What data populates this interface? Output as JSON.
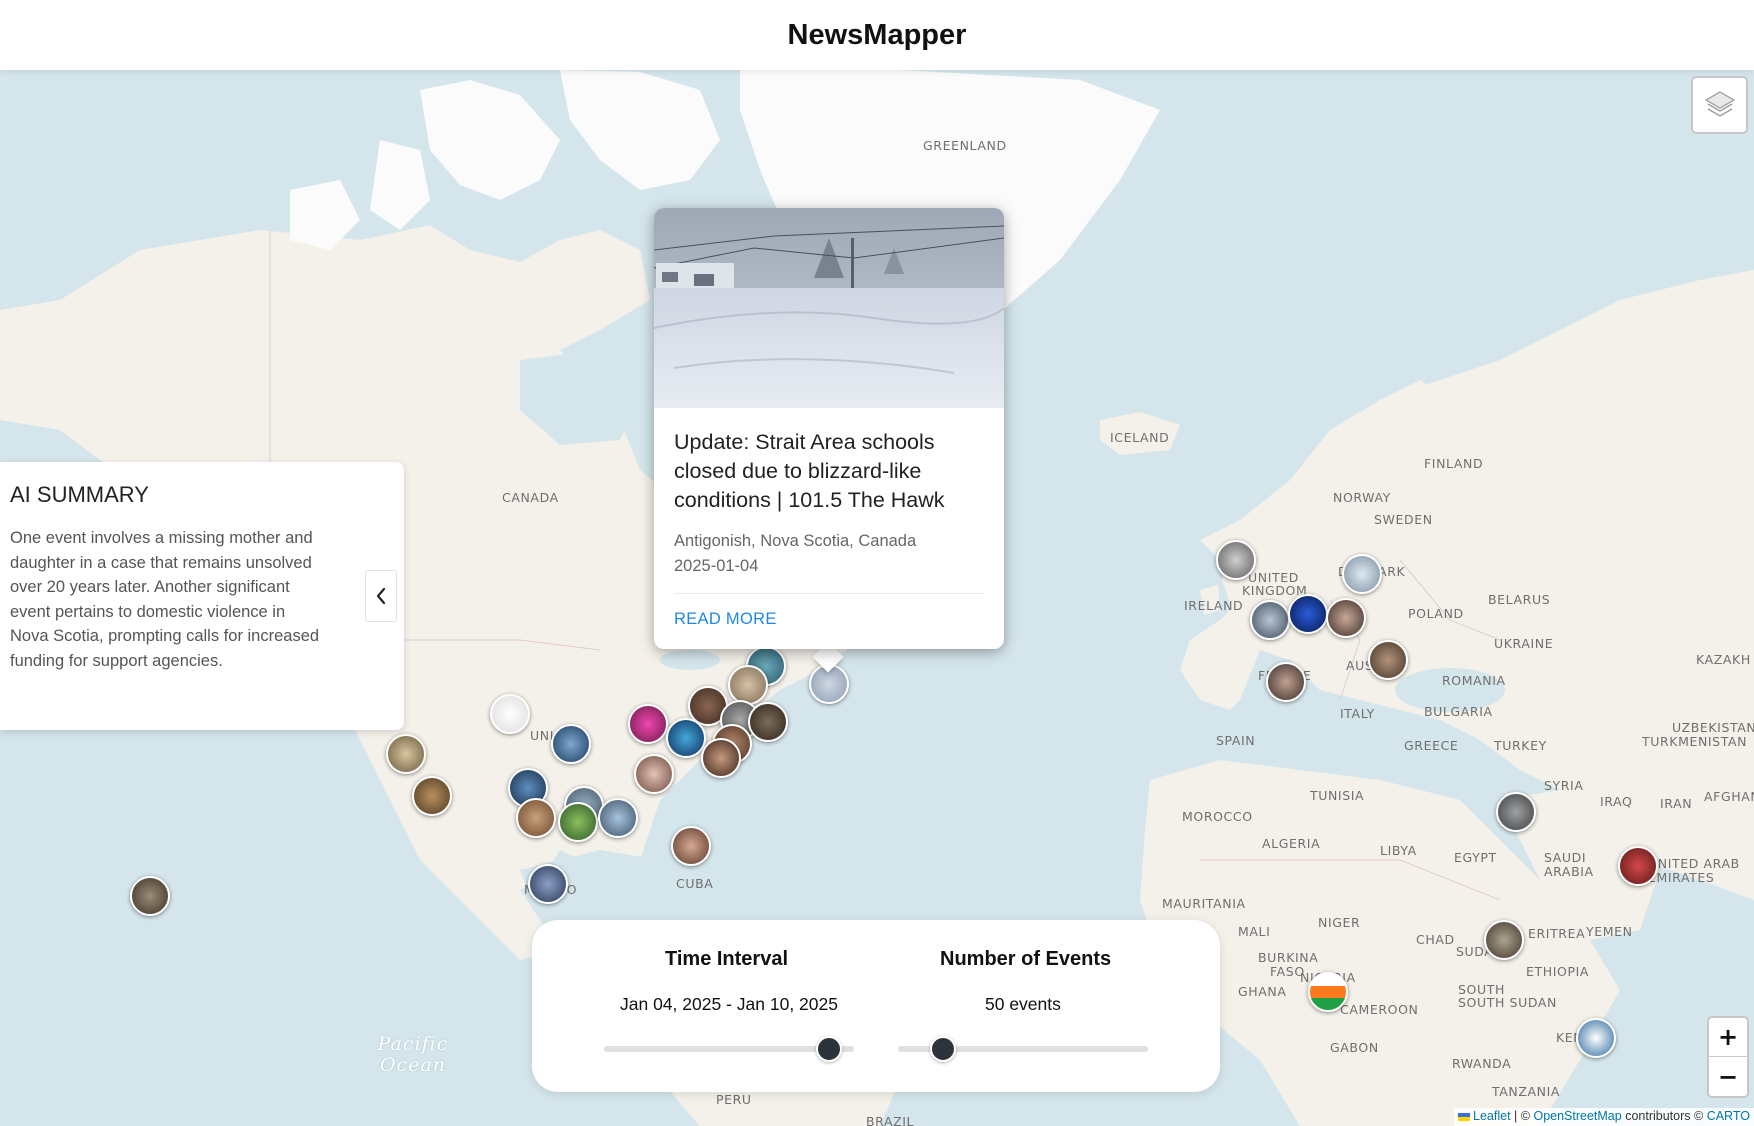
{
  "app": {
    "title": "NewsMapper"
  },
  "map": {
    "labels": [
      "GREENLAND",
      "ICELAND",
      "CANADA",
      "FINLAND",
      "NORWAY",
      "SWEDEN",
      "UNITED",
      "KINGDOM",
      "IRELAND",
      "DENMARK",
      "POLAND",
      "BELARUS",
      "UKRAINE",
      "KAZAKH",
      "FRANCE",
      "AUSTRIA",
      "ROMANIA",
      "ITALY",
      "BULGARIA",
      "SPAIN",
      "GREECE",
      "TURKEY",
      "TURKMENISTAN",
      "UZBEKISTAN",
      "SYRIA",
      "IRAQ",
      "IRAN",
      "AFGHAN",
      "TUNISIA",
      "MOROCCO",
      "ALGERIA",
      "LIBYA",
      "EGYPT",
      "SAUDI",
      "ARABIA",
      "UNITED ARAB",
      "EMIRATES",
      "MAURITANIA",
      "MALI",
      "NIGER",
      "CHAD",
      "SUDAN",
      "ERITREA",
      "YEMEN",
      "ETHIOPIA",
      "SOUTH",
      "SOUTH SUDAN",
      "BURKINA",
      "FASO",
      "GHANA",
      "NIGERIA",
      "CAMEROON",
      "GABON",
      "KENYA",
      "RWANDA",
      "TANZANIA",
      "UNITED STATES",
      "MEXICO",
      "CUBA",
      "PERU",
      "BRAZIL"
    ],
    "ocean_label": "Pacific Ocean",
    "attribution": {
      "leaflet": "Leaflet",
      "sep1": "| ©",
      "osm": "OpenStreetMap",
      "contrib": "contributors ©",
      "carto": "CARTO"
    },
    "zoom_in": "+",
    "zoom_out": "−"
  },
  "summary": {
    "title": "AI SUMMARY",
    "text": "One event involves a missing mother and daughter in a case that remains unsolved over 20 years later. Another significant event pertains to domestic violence in Nova Scotia, prompting calls for increased funding for support agencies."
  },
  "popup": {
    "headline": "Update: Strait Area schools closed due to blizzard-like conditions | 101.5 The Hawk",
    "location": "Antigonish, Nova Scotia, Canada",
    "date": "2025-01-04",
    "link": "READ MORE"
  },
  "controls": {
    "time_title": "Time Interval",
    "time_value_start": "Jan 04, 2025",
    "time_value_sep": "-",
    "time_value_end": "Jan 10, 2025",
    "time_slider_fraction": 0.9,
    "events_title": "Number of Events",
    "events_value": "50 events",
    "events_slider_fraction": 0.18
  },
  "colors": {
    "water": "#d4e6ec",
    "land": "#f4f1ea",
    "ice": "#ffffff",
    "accent": "#1e88e5",
    "thumb": "#2d333a"
  }
}
